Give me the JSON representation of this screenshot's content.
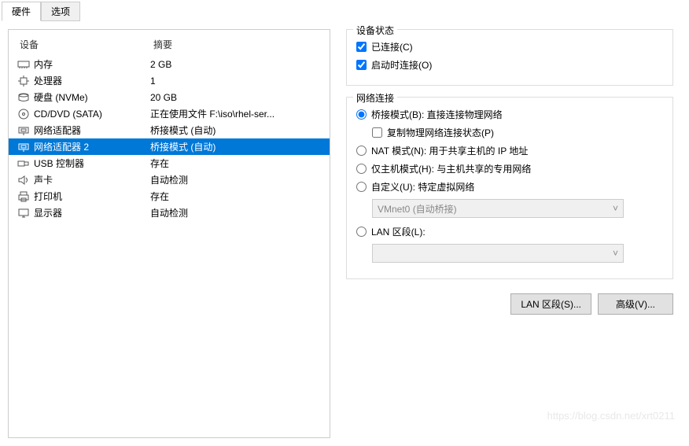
{
  "tabs": {
    "hardware": "硬件",
    "options": "选项"
  },
  "headers": {
    "device": "设备",
    "summary": "摘要"
  },
  "hardware": [
    {
      "icon": "memory",
      "name": "内存",
      "summary": "2 GB"
    },
    {
      "icon": "cpu",
      "name": "处理器",
      "summary": "1"
    },
    {
      "icon": "disk",
      "name": "硬盘 (NVMe)",
      "summary": "20 GB"
    },
    {
      "icon": "cd",
      "name": "CD/DVD (SATA)",
      "summary": "正在使用文件 F:\\iso\\rhel-ser..."
    },
    {
      "icon": "net",
      "name": "网络适配器",
      "summary": "桥接模式 (自动)"
    },
    {
      "icon": "net",
      "name": "网络适配器 2",
      "summary": "桥接模式 (自动)",
      "selected": true
    },
    {
      "icon": "usb",
      "name": "USB 控制器",
      "summary": "存在"
    },
    {
      "icon": "sound",
      "name": "声卡",
      "summary": "自动检测"
    },
    {
      "icon": "printer",
      "name": "打印机",
      "summary": "存在"
    },
    {
      "icon": "display",
      "name": "显示器",
      "summary": "自动检测"
    }
  ],
  "deviceStatus": {
    "title": "设备状态",
    "connected": "已连接(C)",
    "connectOnPower": "启动时连接(O)"
  },
  "network": {
    "title": "网络连接",
    "bridged": "桥接模式(B): 直接连接物理网络",
    "replicate": "复制物理网络连接状态(P)",
    "nat": "NAT 模式(N): 用于共享主机的 IP 地址",
    "hostOnly": "仅主机模式(H): 与主机共享的专用网络",
    "custom": "自定义(U): 特定虚拟网络",
    "customSelect": "VMnet0 (自动桥接)",
    "lan": "LAN 区段(L):",
    "lanSelect": ""
  },
  "buttons": {
    "lanSegments": "LAN 区段(S)...",
    "advanced": "高级(V)..."
  },
  "watermark": "https://blog.csdn.net/xrt0211"
}
